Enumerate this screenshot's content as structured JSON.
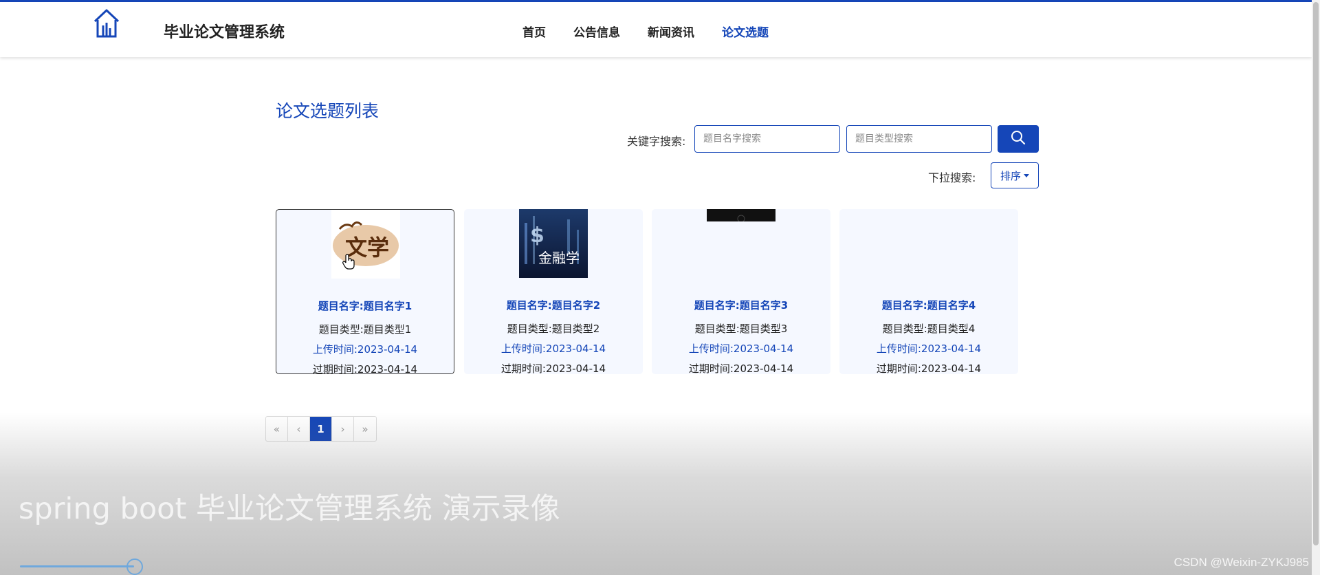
{
  "header": {
    "app_title": "毕业论文管理系统",
    "nav": [
      "首页",
      "公告信息",
      "新闻资讯",
      "论文选题"
    ],
    "active_nav": "论文选题",
    "accent_color": "#1546b8"
  },
  "main": {
    "list_title": "论文选题列表",
    "search": {
      "label": "关键字搜索:",
      "name_placeholder": "题目名字搜索",
      "type_placeholder": "题目类型搜索",
      "button_icon": "search-icon"
    },
    "dropdown": {
      "label": "下拉搜索:",
      "sort_label": "排序"
    },
    "cards": [
      {
        "name": "题目名字:题目名字1",
        "type": "题目类型:题目类型1",
        "upload_time": "上传时间:2023-04-14",
        "expire_time": "过期时间:2023-04-14",
        "thumb_text": "文学"
      },
      {
        "name": "题目名字:题目名字2",
        "type": "题目类型:题目类型2",
        "upload_time": "上传时间:2023-04-14",
        "expire_time": "过期时间:2023-04-14",
        "thumb_text": "金融学"
      },
      {
        "name": "题目名字:题目名字3",
        "type": "题目类型:题目类型3",
        "upload_time": "上传时间:2023-04-14",
        "expire_time": "过期时间:2023-04-14",
        "thumb_text": ""
      },
      {
        "name": "题目名字:题目名字4",
        "type": "题目类型:题目类型4",
        "upload_time": "上传时间:2023-04-14",
        "expire_time": "过期时间:2023-04-14",
        "thumb_text": ""
      }
    ],
    "pagination": {
      "first": "«",
      "prev": "‹",
      "current": "1",
      "next": "›",
      "last": "»"
    }
  },
  "video_overlay": {
    "caption": "spring boot 毕业论文管理系统 演示录像",
    "progress": 0.12,
    "watermark": "CSDN @Weixin-ZYKJ985"
  }
}
